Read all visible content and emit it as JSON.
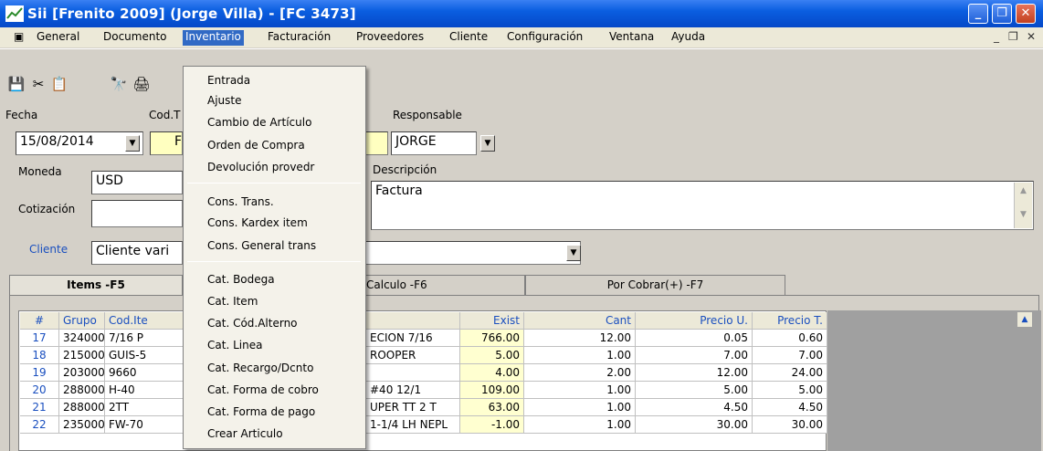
{
  "window": {
    "title": "Sii [Frenito 2009] (Jorge Villa) - [FC 3473]"
  },
  "menubar": {
    "items": [
      "General",
      "Documento",
      "Inventario",
      "Facturación",
      "Proveedores",
      "Cliente",
      "Configuración",
      "Ventana",
      "Ayuda"
    ],
    "active": "Inventario"
  },
  "inventario_menu": {
    "group1": [
      "Entrada",
      "Ajuste",
      "Cambio de Artículo",
      "Orden de Compra",
      "Devolución provedr"
    ],
    "group2": [
      "Cons. Trans.",
      "Cons. Kardex item",
      "Cons. General trans"
    ],
    "group3": [
      "Cat. Bodega",
      "Cat. Item",
      "Cat. Cód.Alterno",
      "Cat. Linea",
      "Cat. Recargo/Dcnto",
      "Cat. Forma de cobro",
      "Cat. Forma de pago",
      "Crear Articulo"
    ]
  },
  "form": {
    "fecha_label": "Fecha",
    "fecha_value": "15/08/2014",
    "codt_label": "Cod.T",
    "codt_value": "F",
    "responsable_label": "Responsable",
    "responsable_value": "JORGE",
    "moneda_label": "Moneda",
    "moneda_value": "USD",
    "descripcion_label": "Descripción",
    "descripcion_value": "Factura",
    "cotizacion_label": "Cotización",
    "cotizacion_value": "",
    "cliente_label": "Cliente",
    "cliente_value": "Cliente vari"
  },
  "tabs": [
    "Items -F5",
    "Calculo -F6",
    "Por Cobrar(+) -F7"
  ],
  "grid": {
    "headers": [
      "#",
      "Grupo",
      "Cod.Ite",
      "",
      "Exist",
      "Cant",
      "Precio U.",
      "Precio T."
    ],
    "rows": [
      [
        "17",
        "324000",
        "7/16 P",
        "ECION 7/16",
        "766.00",
        "12.00",
        "0.05",
        "0.60"
      ],
      [
        "18",
        "215000",
        "GUIS-5",
        "ROOPER",
        "5.00",
        "1.00",
        "7.00",
        "7.00"
      ],
      [
        "19",
        "203000",
        "9660",
        "",
        "4.00",
        "2.00",
        "12.00",
        "24.00"
      ],
      [
        "20",
        "288000",
        "H-40",
        "#40 12/1",
        "109.00",
        "1.00",
        "5.00",
        "5.00"
      ],
      [
        "21",
        "288000",
        "2TT",
        "UPER TT 2 T",
        "63.00",
        "1.00",
        "4.50",
        "4.50"
      ],
      [
        "22",
        "235000",
        "FW-70",
        "1-1/4 LH NEPL",
        "-1.00",
        "1.00",
        "30.00",
        "30.00"
      ]
    ]
  }
}
